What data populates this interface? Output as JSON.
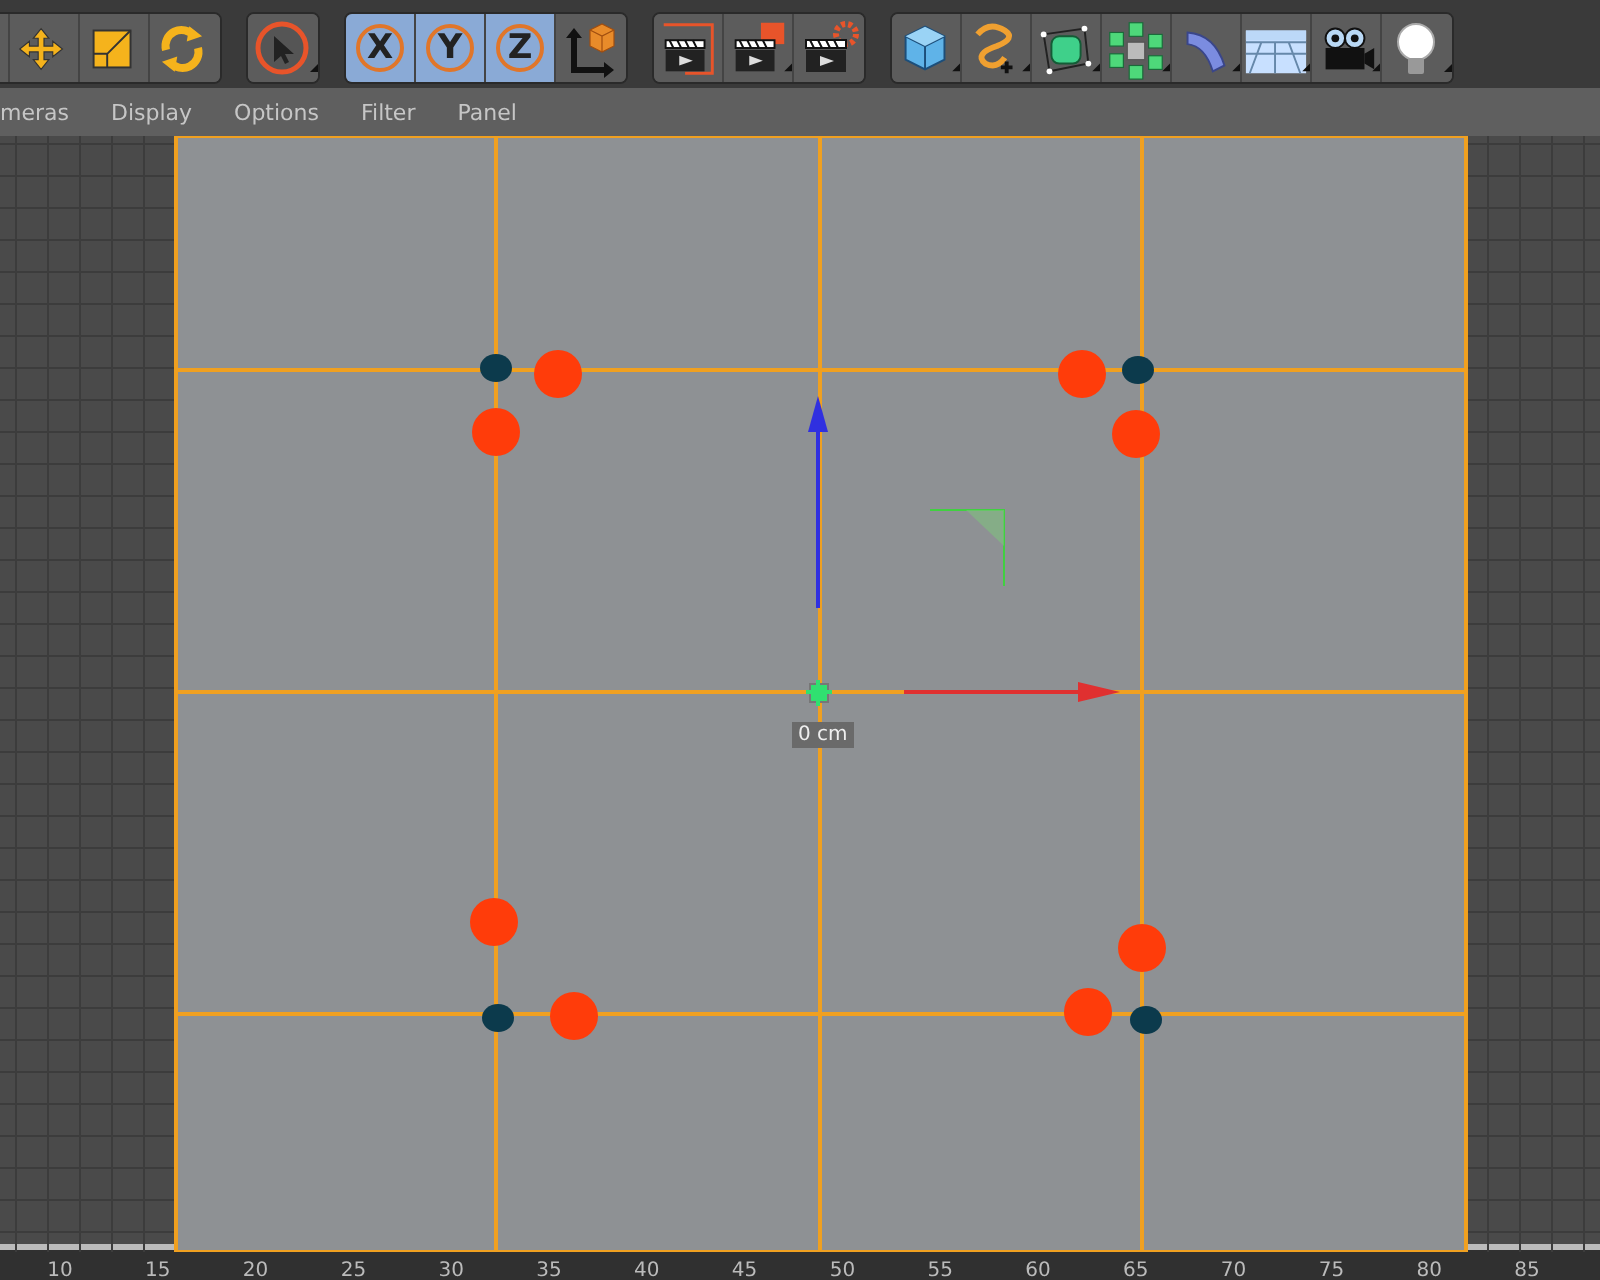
{
  "toolbar": {
    "groups": [
      {
        "items": [
          {
            "kind": "partial"
          },
          {
            "kind": "move",
            "submenu": false
          },
          {
            "kind": "scale",
            "submenu": false
          },
          {
            "kind": "rotate",
            "submenu": false
          }
        ]
      },
      {
        "items": [
          {
            "kind": "select",
            "submenu": true
          }
        ]
      },
      {
        "items": [
          {
            "kind": "axis",
            "label": "X",
            "selected": true
          },
          {
            "kind": "axis",
            "label": "Y",
            "selected": true
          },
          {
            "kind": "axis",
            "label": "Z",
            "selected": true
          },
          {
            "kind": "coord",
            "submenu": false
          }
        ]
      },
      {
        "items": [
          {
            "kind": "render-view",
            "submenu": false
          },
          {
            "kind": "render-region",
            "submenu": true
          },
          {
            "kind": "render-settings",
            "submenu": false
          }
        ]
      },
      {
        "items": [
          {
            "kind": "cube",
            "submenu": true
          },
          {
            "kind": "spline",
            "submenu": true
          },
          {
            "kind": "subdivision",
            "submenu": true
          },
          {
            "kind": "cloner",
            "submenu": true
          },
          {
            "kind": "deformer",
            "submenu": true
          },
          {
            "kind": "floor",
            "submenu": true
          },
          {
            "kind": "camera",
            "submenu": true
          },
          {
            "kind": "light",
            "submenu": true
          }
        ]
      }
    ]
  },
  "menu": [
    "meras",
    "Display",
    "Options",
    "Filter",
    "Panel"
  ],
  "viewport": {
    "origin_label": "0 cm"
  },
  "ruler": [
    "10",
    "15",
    "20",
    "25",
    "30",
    "35",
    "40",
    "45",
    "50",
    "55",
    "60",
    "65",
    "70",
    "75",
    "80",
    "85"
  ]
}
